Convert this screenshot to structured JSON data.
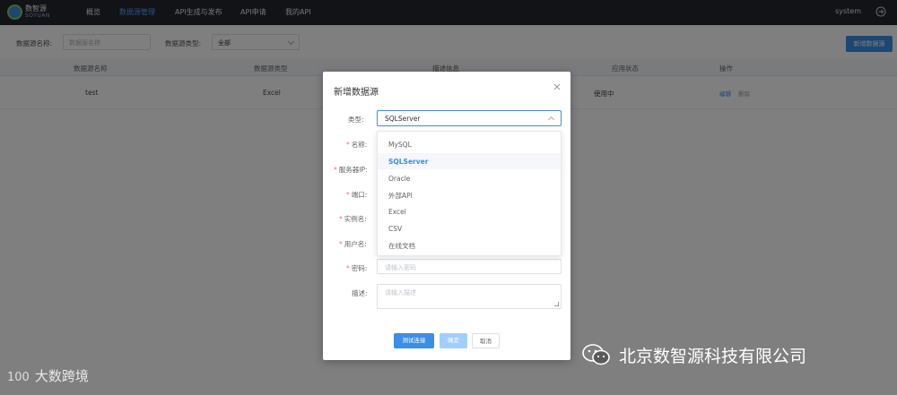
{
  "app": {
    "logo_text": "数智源",
    "logo_sub": "SOYUAN"
  },
  "nav": {
    "items": [
      "概览",
      "数据源管理",
      "API生成与发布",
      "API申请",
      "我的API"
    ],
    "active_index": 1,
    "user": "system",
    "logout_icon": "logout-icon"
  },
  "filters": {
    "name_label": "数据源名称:",
    "name_placeholder": "数据源名称",
    "type_label": "数据源类型:",
    "type_value": "全部",
    "new_button": "新增数据源"
  },
  "table": {
    "columns": [
      "数据源名称",
      "数据源类型",
      "描述信息",
      "应用状态",
      "操作"
    ],
    "rows": [
      {
        "name": "test",
        "type": "Excel",
        "description": "",
        "status": "使用中",
        "actions": [
          "编辑",
          "删除"
        ]
      }
    ]
  },
  "dialog": {
    "title": "新增数据源",
    "close_icon": "close-icon",
    "fields": {
      "type_label": "类型:",
      "type_value": "SQLServer",
      "name_label": "名称:",
      "server_ip_label": "服务器IP:",
      "port_label": "端口:",
      "instance_label": "实例名:",
      "username_label": "用户名:",
      "password_label": "密码:",
      "password_placeholder": "请输入密码",
      "description_label": "描述:",
      "description_placeholder": "请输入描述"
    },
    "dropdown_options": [
      "MySQL",
      "SQLServer",
      "Oracle",
      "外部API",
      "Excel",
      "CSV",
      "在线文档"
    ],
    "selected_option": "SQLServer",
    "buttons": {
      "test": "测试连接",
      "confirm": "确定",
      "cancel": "取消"
    }
  },
  "watermarks": {
    "left_logo": "100",
    "left_text": "大数跨境",
    "right_icon": "wechat-icon",
    "right_text": "北京数智源科技有限公司"
  },
  "colors": {
    "accent": "#3a8ee6",
    "topbar": "#23262e",
    "required": "#f56c6c"
  }
}
